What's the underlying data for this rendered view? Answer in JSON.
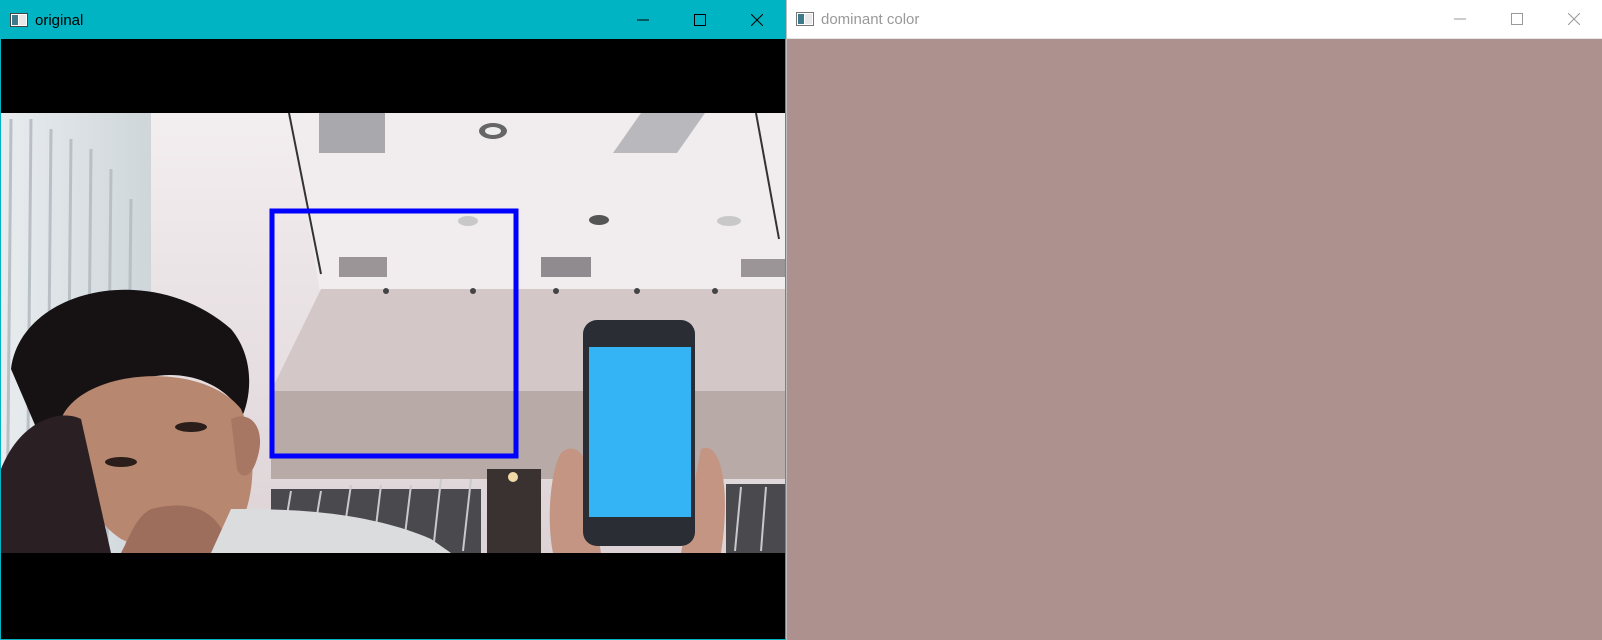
{
  "windows": {
    "original": {
      "title": "original",
      "titlebar_color": "#00b4c3",
      "icons": {
        "app": "opencv-window-icon",
        "minimize": "minimize-icon",
        "maximize": "maximize-icon",
        "close": "close-icon"
      }
    },
    "dominant": {
      "title": "dominant color",
      "titlebar_color": "#ffffff",
      "swatch_color": "#ad918f",
      "icons": {
        "app": "opencv-window-icon",
        "minimize": "minimize-icon",
        "maximize": "maximize-icon",
        "close": "close-icon"
      }
    }
  },
  "frame": {
    "roi_box_color": "#0000ff",
    "phone_screen_color": "#35b4f5"
  }
}
